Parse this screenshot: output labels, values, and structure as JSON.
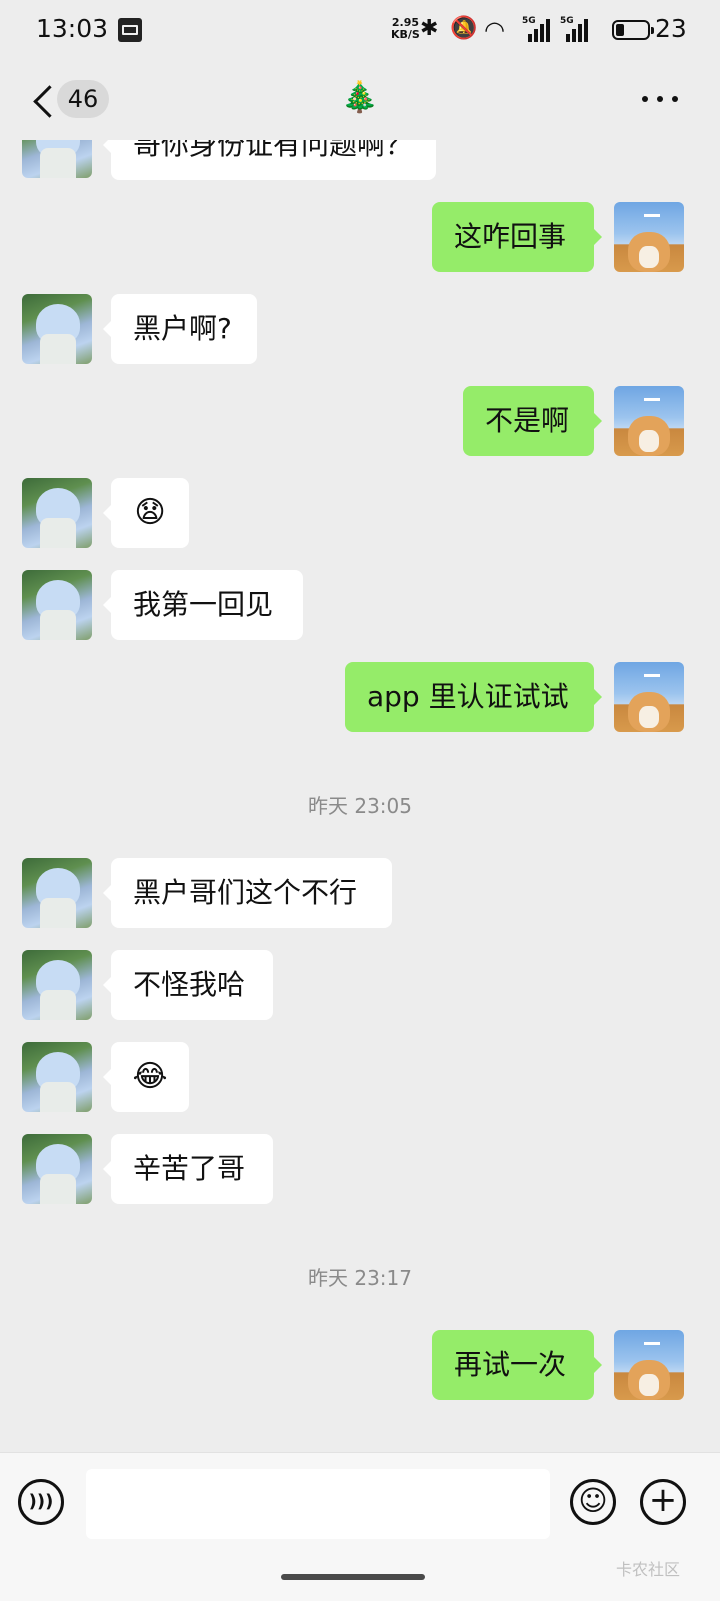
{
  "status_bar": {
    "time": "13:03",
    "net_speed_value": "2.95",
    "net_speed_unit": "KB/S",
    "signal1_label": "5G",
    "signal2_label": "5G",
    "battery_level": "23"
  },
  "nav": {
    "unread_count": "46",
    "title": "🎄",
    "more_icon": "ellipsis-icon"
  },
  "messages": [
    {
      "side": "left",
      "text": "哥你身份证有问题啊？"
    },
    {
      "side": "right",
      "text": "这咋回事"
    },
    {
      "side": "left",
      "text": "黑户啊?"
    },
    {
      "side": "right",
      "text": "不是啊"
    },
    {
      "side": "left",
      "emoji": "😧"
    },
    {
      "side": "left",
      "text": "我第一回见"
    },
    {
      "side": "right",
      "text": "app 里认证试试"
    },
    {
      "timestamp": "昨天 23:05"
    },
    {
      "side": "left",
      "text": "黑户哥们这个不行"
    },
    {
      "side": "left",
      "text": "不怪我哈"
    },
    {
      "side": "left",
      "emoji": "😂"
    },
    {
      "side": "left",
      "text": "辛苦了哥"
    },
    {
      "timestamp": "昨天 23:17"
    },
    {
      "side": "right",
      "text": "再试一次"
    }
  ],
  "input_bar": {
    "value": "",
    "voice_icon": "voice-icon",
    "emoji_icon": "emoji-icon",
    "plus_icon": "plus-icon"
  },
  "watermark": "卡农社区"
}
